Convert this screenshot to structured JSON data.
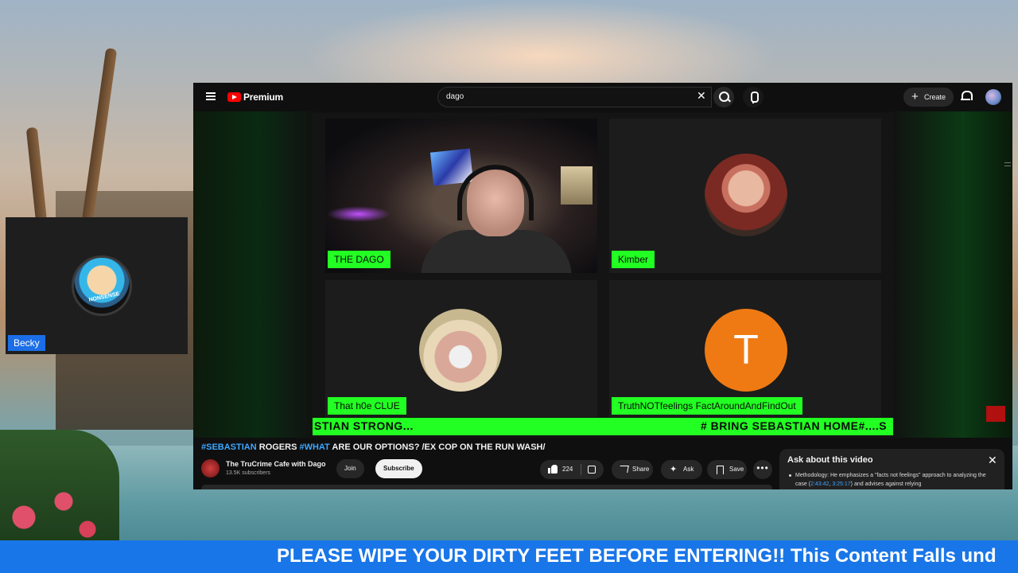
{
  "side_participant": {
    "name": "Becky",
    "avatar_text": "NONSENSE"
  },
  "youtube": {
    "logo_text": "Premium",
    "search": {
      "value": "dago"
    },
    "create_label": "Create",
    "stage": {
      "participants": [
        {
          "name": "THE DAGO"
        },
        {
          "name": "Kimber"
        },
        {
          "name": "That h0e CLUE"
        },
        {
          "name": "TruthNOTfeelings FactAroundAndFindOut",
          "initial": "T"
        }
      ],
      "ticker_left": "STIAN STRONG...",
      "ticker_right": "# BRING SEBASTIAN HOME#....S"
    },
    "video": {
      "title_hashtag_1": "#SEBASTIAN",
      "title_part_1": " ROGERS ",
      "title_hashtag_2": "#WHAT",
      "title_part_2": " ARE OUR OPTIONS? /EX COP ON THE RUN WASH/"
    },
    "channel": {
      "name": "The TruCrime Cafe with Dago",
      "subscribers": "13.5K subscribers"
    },
    "join_label": "Join",
    "subscribe_label": "Subscribe",
    "like_count": "224",
    "share_label": "Share",
    "ask_label": "Ask",
    "save_label": "Save",
    "more_label": "•••",
    "ask_panel": {
      "title": "Ask about this video",
      "close": "✕",
      "text_lead": "Methodology: He emphasizes a \"facts not feelings\" approach to analyzing the case (",
      "ts1": "2:43:42",
      "sep": ", ",
      "ts2": "3:25:17",
      "text_tail": ") and advises against relying"
    }
  },
  "banner": {
    "text": "PLEASE WIPE YOUR DIRTY FEET BEFORE ENTERING!! This Content Falls und"
  },
  "colors": {
    "accent_green": "#22ff22",
    "yt_red": "#ff0000",
    "banner_blue": "#1976e8",
    "link_blue": "#3ea6ff"
  }
}
